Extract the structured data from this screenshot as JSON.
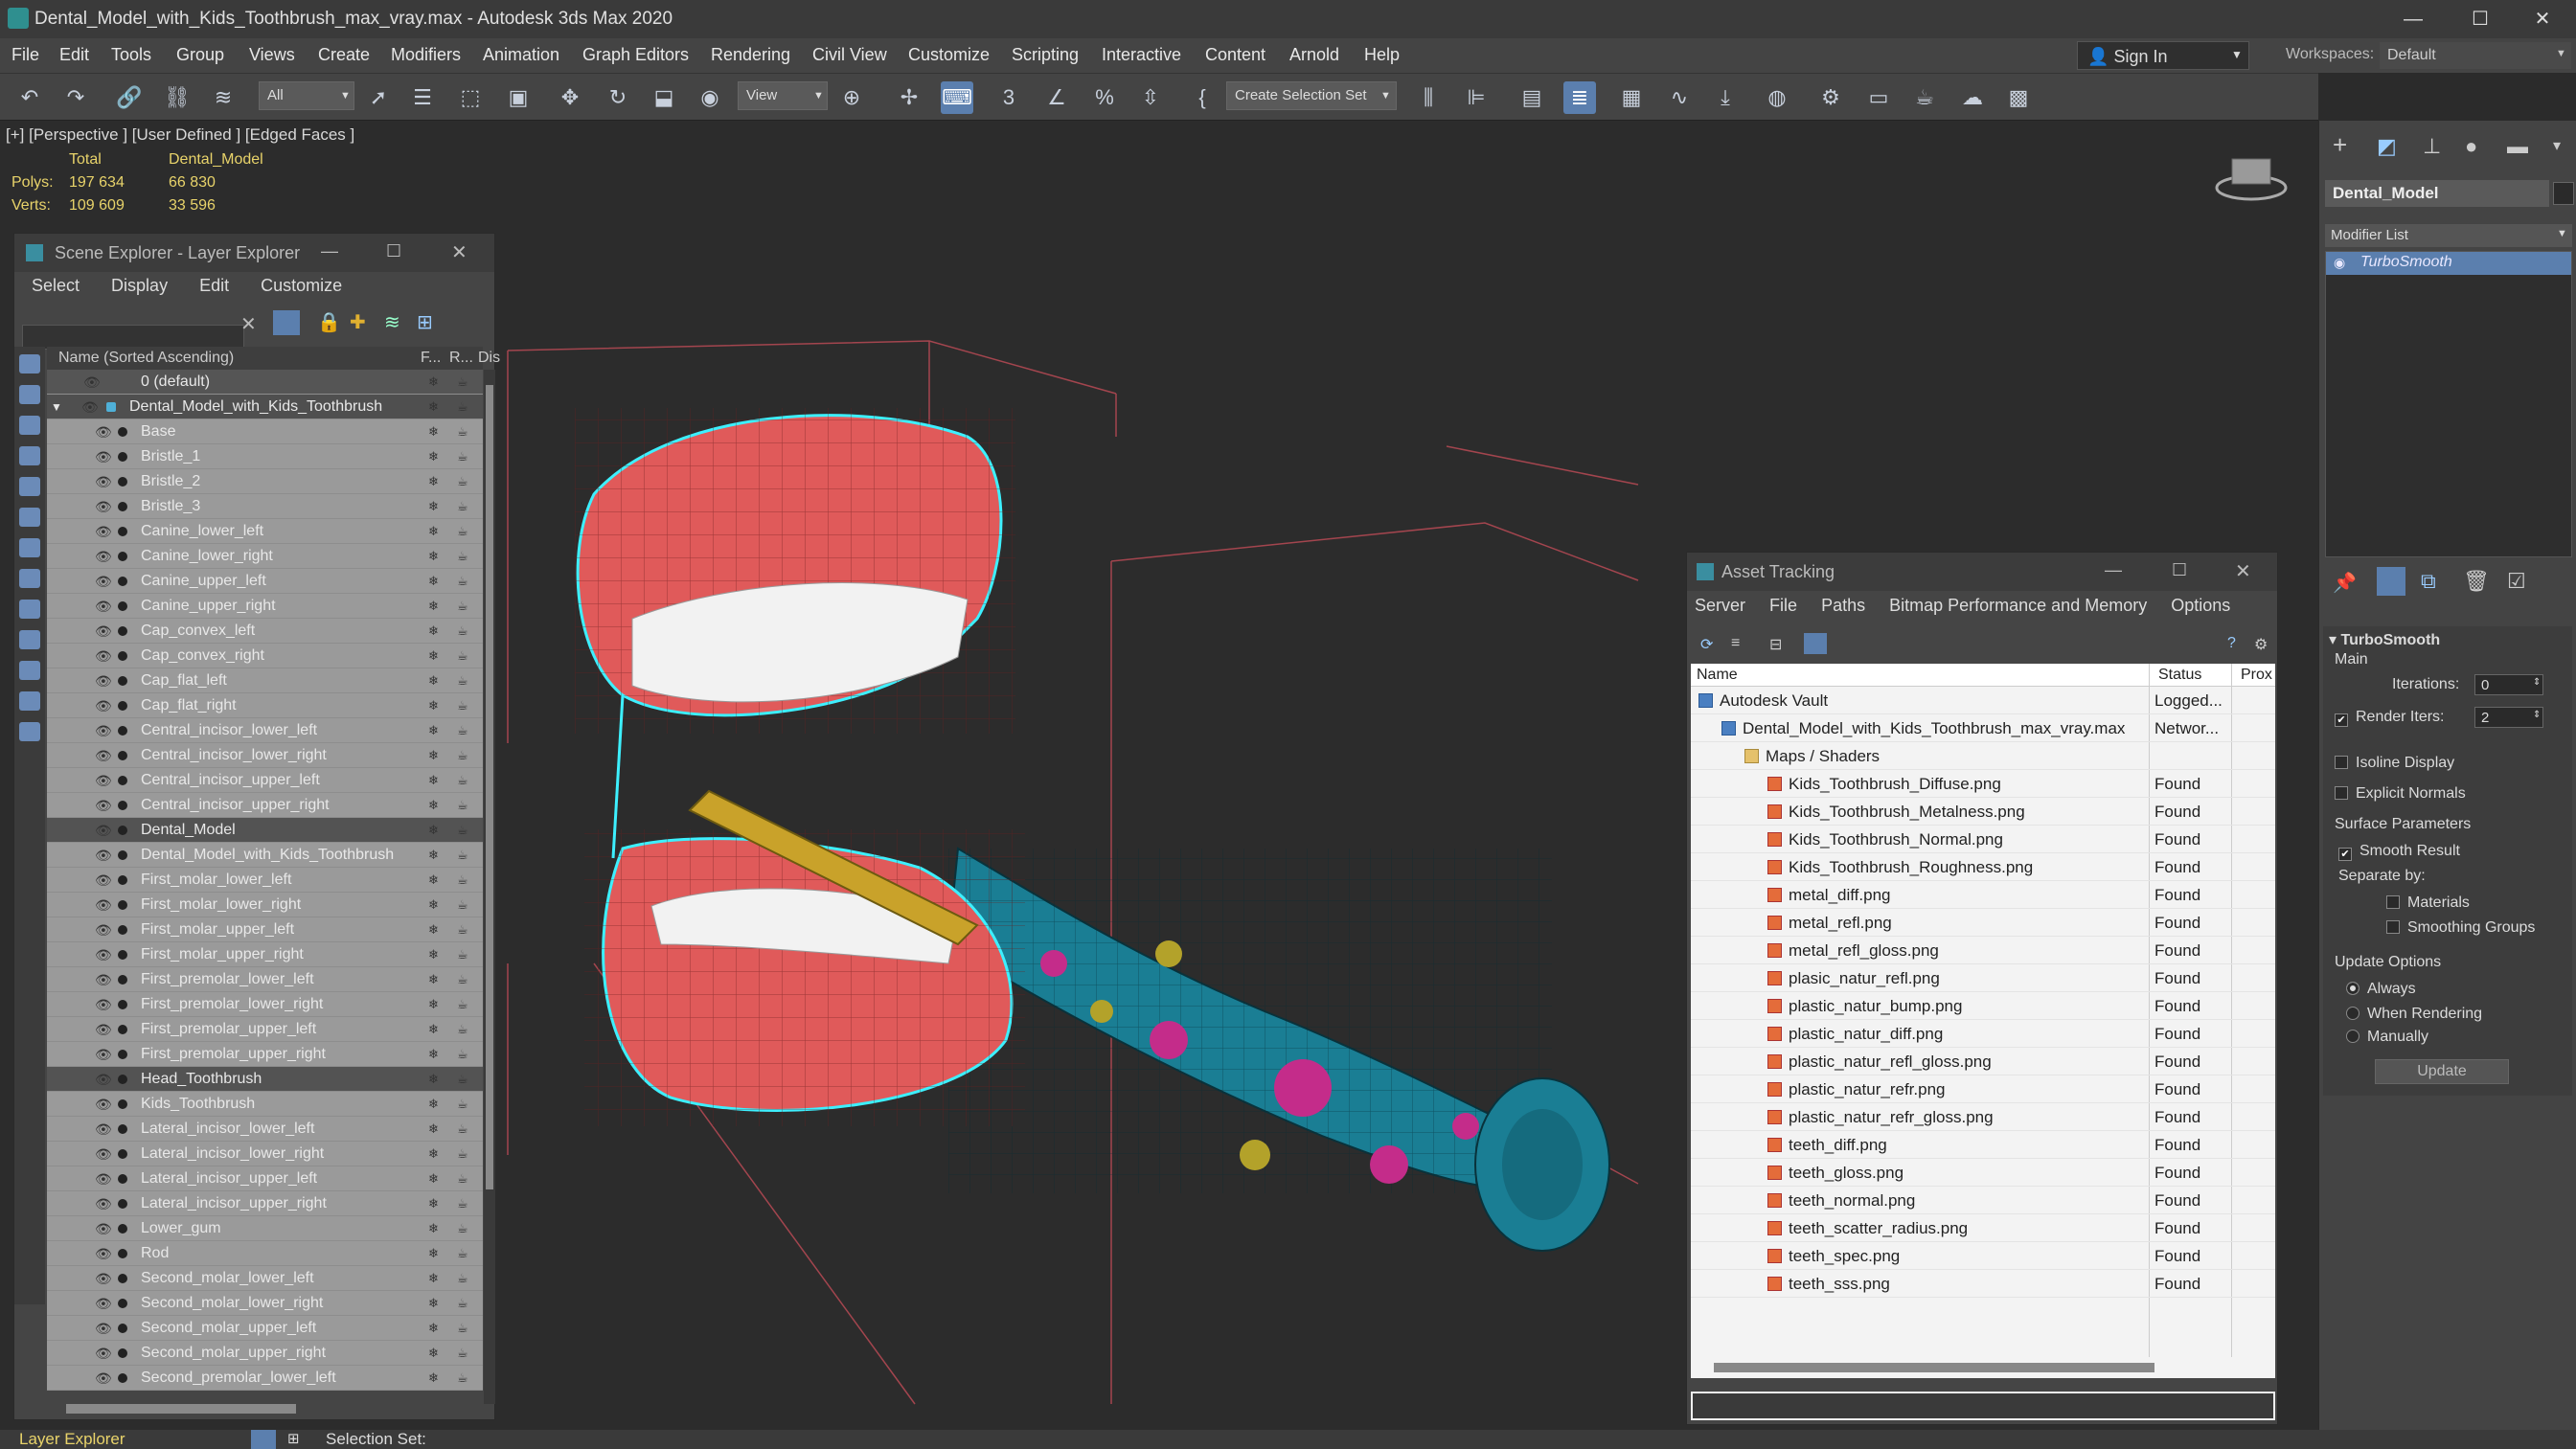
{
  "window": {
    "title": "Dental_Model_with_Kids_Toothbrush_max_vray.max - Autodesk 3ds Max 2020"
  },
  "menu": [
    "File",
    "Edit",
    "Tools",
    "Group",
    "Views",
    "Create",
    "Modifiers",
    "Animation",
    "Graph Editors",
    "Rendering",
    "Civil View",
    "Customize",
    "Scripting",
    "Interactive",
    "Content",
    "Arnold",
    "Help"
  ],
  "account": {
    "sign_in": "Sign In",
    "workspaces_label": "Workspaces:",
    "workspace": "Default"
  },
  "toolbar": {
    "filter": "All",
    "refcoord": "View",
    "selection_set": "Create Selection Set"
  },
  "viewport": {
    "label": "[+] [Perspective ] [User Defined ] [Edged Faces ]",
    "stats": {
      "col_total": "Total",
      "col_obj": "Dental_Model",
      "polys_label": "Polys:",
      "polys_total": "197 634",
      "polys_obj": "66 830",
      "verts_label": "Verts:",
      "verts_total": "109 609",
      "verts_obj": "33 596"
    }
  },
  "scene_explorer": {
    "title": "Scene Explorer - Layer Explorer",
    "menu": [
      "Select",
      "Display",
      "Edit",
      "Customize"
    ],
    "col_name": "Name (Sorted Ascending)",
    "col_f": "F...",
    "col_r": "R...",
    "col_dis": "Dis",
    "rows": [
      "0 (default)",
      "Dental_Model_with_Kids_Toothbrush",
      "Base",
      "Bristle_1",
      "Bristle_2",
      "Bristle_3",
      "Canine_lower_left",
      "Canine_lower_right",
      "Canine_upper_left",
      "Canine_upper_right",
      "Cap_convex_left",
      "Cap_convex_right",
      "Cap_flat_left",
      "Cap_flat_right",
      "Central_incisor_lower_left",
      "Central_incisor_lower_right",
      "Central_incisor_upper_left",
      "Central_incisor_upper_right",
      "Dental_Model",
      "Dental_Model_with_Kids_Toothbrush",
      "First_molar_lower_left",
      "First_molar_lower_right",
      "First_molar_upper_left",
      "First_molar_upper_right",
      "First_premolar_lower_left",
      "First_premolar_lower_right",
      "First_premolar_upper_left",
      "First_premolar_upper_right",
      "Head_Toothbrush",
      "Kids_Toothbrush",
      "Lateral_incisor_lower_left",
      "Lateral_incisor_lower_right",
      "Lateral_incisor_upper_left",
      "Lateral_incisor_upper_right",
      "Lower_gum",
      "Rod",
      "Second_molar_lower_left",
      "Second_molar_lower_right",
      "Second_molar_upper_left",
      "Second_molar_upper_right",
      "Second_premolar_lower_left"
    ]
  },
  "asset_tracking": {
    "title": "Asset Tracking",
    "menu": [
      "Server",
      "File",
      "Paths",
      "Bitmap Performance and Memory",
      "Options"
    ],
    "col_name": "Name",
    "col_status": "Status",
    "col_proxy": "Prox",
    "rows": [
      {
        "name": "Autodesk Vault",
        "status": "Logged...",
        "indent": 0,
        "kind": "vault"
      },
      {
        "name": "Dental_Model_with_Kids_Toothbrush_max_vray.max",
        "status": "Networ...",
        "indent": 1,
        "kind": "max"
      },
      {
        "name": "Maps / Shaders",
        "status": "",
        "indent": 2,
        "kind": "folder"
      },
      {
        "name": "Kids_Toothbrush_Diffuse.png",
        "status": "Found",
        "indent": 3,
        "kind": "img"
      },
      {
        "name": "Kids_Toothbrush_Metalness.png",
        "status": "Found",
        "indent": 3,
        "kind": "img"
      },
      {
        "name": "Kids_Toothbrush_Normal.png",
        "status": "Found",
        "indent": 3,
        "kind": "img"
      },
      {
        "name": "Kids_Toothbrush_Roughness.png",
        "status": "Found",
        "indent": 3,
        "kind": "img"
      },
      {
        "name": "metal_diff.png",
        "status": "Found",
        "indent": 3,
        "kind": "img"
      },
      {
        "name": "metal_refl.png",
        "status": "Found",
        "indent": 3,
        "kind": "img"
      },
      {
        "name": "metal_refl_gloss.png",
        "status": "Found",
        "indent": 3,
        "kind": "img"
      },
      {
        "name": "plasic_natur_refl.png",
        "status": "Found",
        "indent": 3,
        "kind": "img"
      },
      {
        "name": "plastic_natur_bump.png",
        "status": "Found",
        "indent": 3,
        "kind": "img"
      },
      {
        "name": "plastic_natur_diff.png",
        "status": "Found",
        "indent": 3,
        "kind": "img"
      },
      {
        "name": "plastic_natur_refl_gloss.png",
        "status": "Found",
        "indent": 3,
        "kind": "img"
      },
      {
        "name": "plastic_natur_refr.png",
        "status": "Found",
        "indent": 3,
        "kind": "img"
      },
      {
        "name": "plastic_natur_refr_gloss.png",
        "status": "Found",
        "indent": 3,
        "kind": "img"
      },
      {
        "name": "teeth_diff.png",
        "status": "Found",
        "indent": 3,
        "kind": "img"
      },
      {
        "name": "teeth_gloss.png",
        "status": "Found",
        "indent": 3,
        "kind": "img"
      },
      {
        "name": "teeth_normal.png",
        "status": "Found",
        "indent": 3,
        "kind": "img"
      },
      {
        "name": "teeth_scatter_radius.png",
        "status": "Found",
        "indent": 3,
        "kind": "img"
      },
      {
        "name": "teeth_spec.png",
        "status": "Found",
        "indent": 3,
        "kind": "img"
      },
      {
        "name": "teeth_sss.png",
        "status": "Found",
        "indent": 3,
        "kind": "img"
      }
    ]
  },
  "command_panel": {
    "object_name": "Dental_Model",
    "modifier_list": "Modifier List",
    "stack_item": "TurboSmooth",
    "rollout": "TurboSmooth",
    "main": "Main",
    "iterations_label": "Iterations:",
    "iterations": "0",
    "render_iters_label": "Render Iters:",
    "render_iters": "2",
    "isoline": "Isoline Display",
    "explicit": "Explicit Normals",
    "surface_params": "Surface Parameters",
    "smooth_result": "Smooth Result",
    "separate_by": "Separate by:",
    "materials": "Materials",
    "smoothing_groups": "Smoothing Groups",
    "update_options": "Update Options",
    "always": "Always",
    "when_rendering": "When Rendering",
    "manually": "Manually",
    "update": "Update"
  },
  "status": {
    "layer_explorer": "Layer Explorer",
    "selection_set": "Selection Set:"
  }
}
